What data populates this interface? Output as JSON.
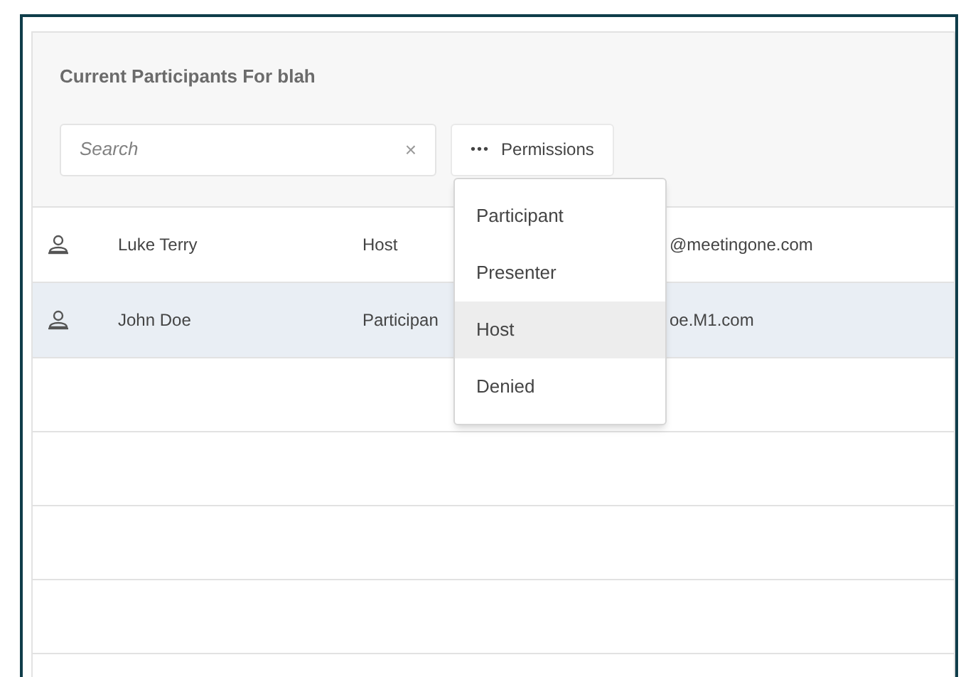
{
  "panel": {
    "title": "Current Participants For blah"
  },
  "search": {
    "placeholder": "Search",
    "clear": "×"
  },
  "permissions_button": {
    "icon": "•••",
    "label": "Permissions"
  },
  "participants": [
    {
      "name": "Luke Terry",
      "role": "Host",
      "email": "@meetingone.com",
      "selected": false
    },
    {
      "name": "John Doe",
      "role": "Participan",
      "email": "oe.M1.com",
      "selected": true
    }
  ],
  "permissions_menu": [
    {
      "label": "Participant",
      "highlighted": false
    },
    {
      "label": "Presenter",
      "highlighted": false
    },
    {
      "label": "Host",
      "highlighted": true
    },
    {
      "label": "Denied",
      "highlighted": false
    }
  ]
}
